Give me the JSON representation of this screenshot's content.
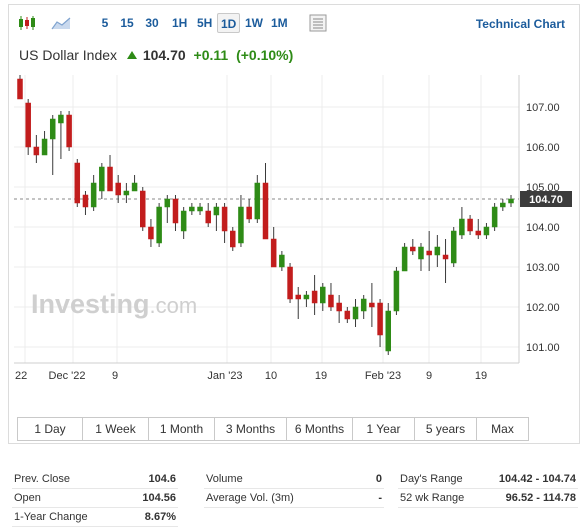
{
  "toolbar": {
    "timeframes": [
      "5",
      "15",
      "30",
      "1H",
      "5H",
      "1D",
      "1W",
      "1M"
    ],
    "active_timeframe": "1D",
    "technical_chart_label": "Technical Chart"
  },
  "header": {
    "name": "US Dollar Index",
    "price": "104.70",
    "change": "+0.11",
    "change_pct": "(+0.10%)"
  },
  "watermark": "Investing",
  "watermark_suffix": ".com",
  "colors": {
    "up": "#2e8b16",
    "down": "#c21d1d",
    "accent": "#1c5c9c"
  },
  "chart_data": {
    "type": "candlestick",
    "y_ticks": [
      "107.00",
      "106.00",
      "105.00",
      "104.00",
      "103.00",
      "102.00",
      "101.00"
    ],
    "y_range": [
      100.6,
      107.8
    ],
    "last_price_label": "104.70",
    "last_price": 104.7,
    "x_tick_labels": [
      "22",
      "Dec '22",
      "9",
      "Jan '23",
      "10",
      "19",
      "Feb '23",
      "9",
      "19"
    ],
    "candles": [
      {
        "o": 107.7,
        "h": 107.8,
        "l": 107.2,
        "c": 107.2
      },
      {
        "o": 107.1,
        "h": 107.2,
        "l": 105.8,
        "c": 106.0
      },
      {
        "o": 106.0,
        "h": 106.3,
        "l": 105.6,
        "c": 105.8
      },
      {
        "o": 105.8,
        "h": 106.4,
        "l": 105.8,
        "c": 106.2
      },
      {
        "o": 106.2,
        "h": 106.8,
        "l": 105.3,
        "c": 106.7
      },
      {
        "o": 106.6,
        "h": 106.9,
        "l": 105.7,
        "c": 106.8
      },
      {
        "o": 106.8,
        "h": 106.9,
        "l": 105.9,
        "c": 106.0
      },
      {
        "o": 105.6,
        "h": 105.7,
        "l": 104.5,
        "c": 104.6
      },
      {
        "o": 104.8,
        "h": 104.9,
        "l": 104.3,
        "c": 104.5
      },
      {
        "o": 104.5,
        "h": 105.3,
        "l": 104.4,
        "c": 105.1
      },
      {
        "o": 104.9,
        "h": 105.6,
        "l": 104.7,
        "c": 105.5
      },
      {
        "o": 105.5,
        "h": 105.8,
        "l": 104.9,
        "c": 104.9
      },
      {
        "o": 105.1,
        "h": 105.3,
        "l": 104.6,
        "c": 104.8
      },
      {
        "o": 104.8,
        "h": 105.1,
        "l": 104.6,
        "c": 104.9
      },
      {
        "o": 104.9,
        "h": 105.3,
        "l": 104.9,
        "c": 105.1
      },
      {
        "o": 104.9,
        "h": 105.0,
        "l": 103.9,
        "c": 104.0
      },
      {
        "o": 104.0,
        "h": 104.2,
        "l": 103.5,
        "c": 103.7
      },
      {
        "o": 103.6,
        "h": 104.6,
        "l": 103.5,
        "c": 104.5
      },
      {
        "o": 104.5,
        "h": 104.8,
        "l": 104.1,
        "c": 104.7
      },
      {
        "o": 104.7,
        "h": 104.8,
        "l": 103.9,
        "c": 104.1
      },
      {
        "o": 103.9,
        "h": 104.5,
        "l": 103.7,
        "c": 104.4
      },
      {
        "o": 104.4,
        "h": 104.6,
        "l": 104.3,
        "c": 104.5
      },
      {
        "o": 104.4,
        "h": 104.6,
        "l": 104.3,
        "c": 104.5
      },
      {
        "o": 104.4,
        "h": 104.6,
        "l": 104.0,
        "c": 104.1
      },
      {
        "o": 104.3,
        "h": 104.6,
        "l": 103.9,
        "c": 104.5
      },
      {
        "o": 104.5,
        "h": 104.6,
        "l": 103.6,
        "c": 103.9
      },
      {
        "o": 103.9,
        "h": 104.0,
        "l": 103.4,
        "c": 103.5
      },
      {
        "o": 103.6,
        "h": 104.8,
        "l": 103.5,
        "c": 104.5
      },
      {
        "o": 104.5,
        "h": 104.7,
        "l": 104.1,
        "c": 104.2
      },
      {
        "o": 104.2,
        "h": 105.3,
        "l": 104.1,
        "c": 105.1
      },
      {
        "o": 105.1,
        "h": 105.6,
        "l": 103.7,
        "c": 103.7
      },
      {
        "o": 103.7,
        "h": 104.0,
        "l": 103.0,
        "c": 103.0
      },
      {
        "o": 103.0,
        "h": 103.4,
        "l": 102.9,
        "c": 103.3
      },
      {
        "o": 103.0,
        "h": 103.1,
        "l": 102.1,
        "c": 102.2
      },
      {
        "o": 102.3,
        "h": 102.5,
        "l": 101.7,
        "c": 102.2
      },
      {
        "o": 102.2,
        "h": 102.4,
        "l": 102.0,
        "c": 102.3
      },
      {
        "o": 102.4,
        "h": 102.8,
        "l": 101.8,
        "c": 102.1
      },
      {
        "o": 102.1,
        "h": 102.6,
        "l": 101.9,
        "c": 102.5
      },
      {
        "o": 102.3,
        "h": 102.6,
        "l": 101.9,
        "c": 102.0
      },
      {
        "o": 102.1,
        "h": 102.3,
        "l": 101.6,
        "c": 101.9
      },
      {
        "o": 101.9,
        "h": 102.0,
        "l": 101.6,
        "c": 101.7
      },
      {
        "o": 101.7,
        "h": 102.2,
        "l": 101.5,
        "c": 102.0
      },
      {
        "o": 101.9,
        "h": 102.3,
        "l": 101.7,
        "c": 102.2
      },
      {
        "o": 102.1,
        "h": 102.6,
        "l": 101.5,
        "c": 102.0
      },
      {
        "o": 102.1,
        "h": 102.2,
        "l": 101.0,
        "c": 101.3
      },
      {
        "o": 100.9,
        "h": 102.1,
        "l": 100.8,
        "c": 101.9
      },
      {
        "o": 101.9,
        "h": 103.0,
        "l": 101.8,
        "c": 102.9
      },
      {
        "o": 102.9,
        "h": 103.6,
        "l": 102.9,
        "c": 103.5
      },
      {
        "o": 103.5,
        "h": 103.7,
        "l": 103.3,
        "c": 103.4
      },
      {
        "o": 103.2,
        "h": 103.6,
        "l": 102.9,
        "c": 103.5
      },
      {
        "o": 103.4,
        "h": 103.9,
        "l": 102.9,
        "c": 103.3
      },
      {
        "o": 103.3,
        "h": 103.8,
        "l": 103.0,
        "c": 103.5
      },
      {
        "o": 103.3,
        "h": 103.7,
        "l": 102.6,
        "c": 103.2
      },
      {
        "o": 103.1,
        "h": 104.0,
        "l": 103.0,
        "c": 103.9
      },
      {
        "o": 103.8,
        "h": 104.5,
        "l": 103.7,
        "c": 104.2
      },
      {
        "o": 104.2,
        "h": 104.3,
        "l": 103.8,
        "c": 103.9
      },
      {
        "o": 103.9,
        "h": 104.2,
        "l": 103.7,
        "c": 103.8
      },
      {
        "o": 103.8,
        "h": 104.1,
        "l": 103.7,
        "c": 104.0
      },
      {
        "o": 104.0,
        "h": 104.6,
        "l": 103.9,
        "c": 104.5
      },
      {
        "o": 104.5,
        "h": 104.7,
        "l": 104.4,
        "c": 104.6
      },
      {
        "o": 104.6,
        "h": 104.8,
        "l": 104.5,
        "c": 104.7
      }
    ]
  },
  "ranges": [
    "1 Day",
    "1 Week",
    "1 Month",
    "3 Months",
    "6 Months",
    "1 Year",
    "5 years",
    "Max"
  ],
  "stats": {
    "col1": [
      {
        "label": "Prev. Close",
        "value": "104.6"
      },
      {
        "label": "Open",
        "value": "104.56"
      },
      {
        "label": "1-Year Change",
        "value": "8.67%"
      }
    ],
    "col2": [
      {
        "label": "Volume",
        "value": "0"
      },
      {
        "label": "Average Vol. (3m)",
        "value": "-"
      }
    ],
    "col3": [
      {
        "label": "Day's Range",
        "value": "104.42 - 104.74"
      },
      {
        "label": "52 wk Range",
        "value": "96.52 - 114.78"
      }
    ]
  }
}
